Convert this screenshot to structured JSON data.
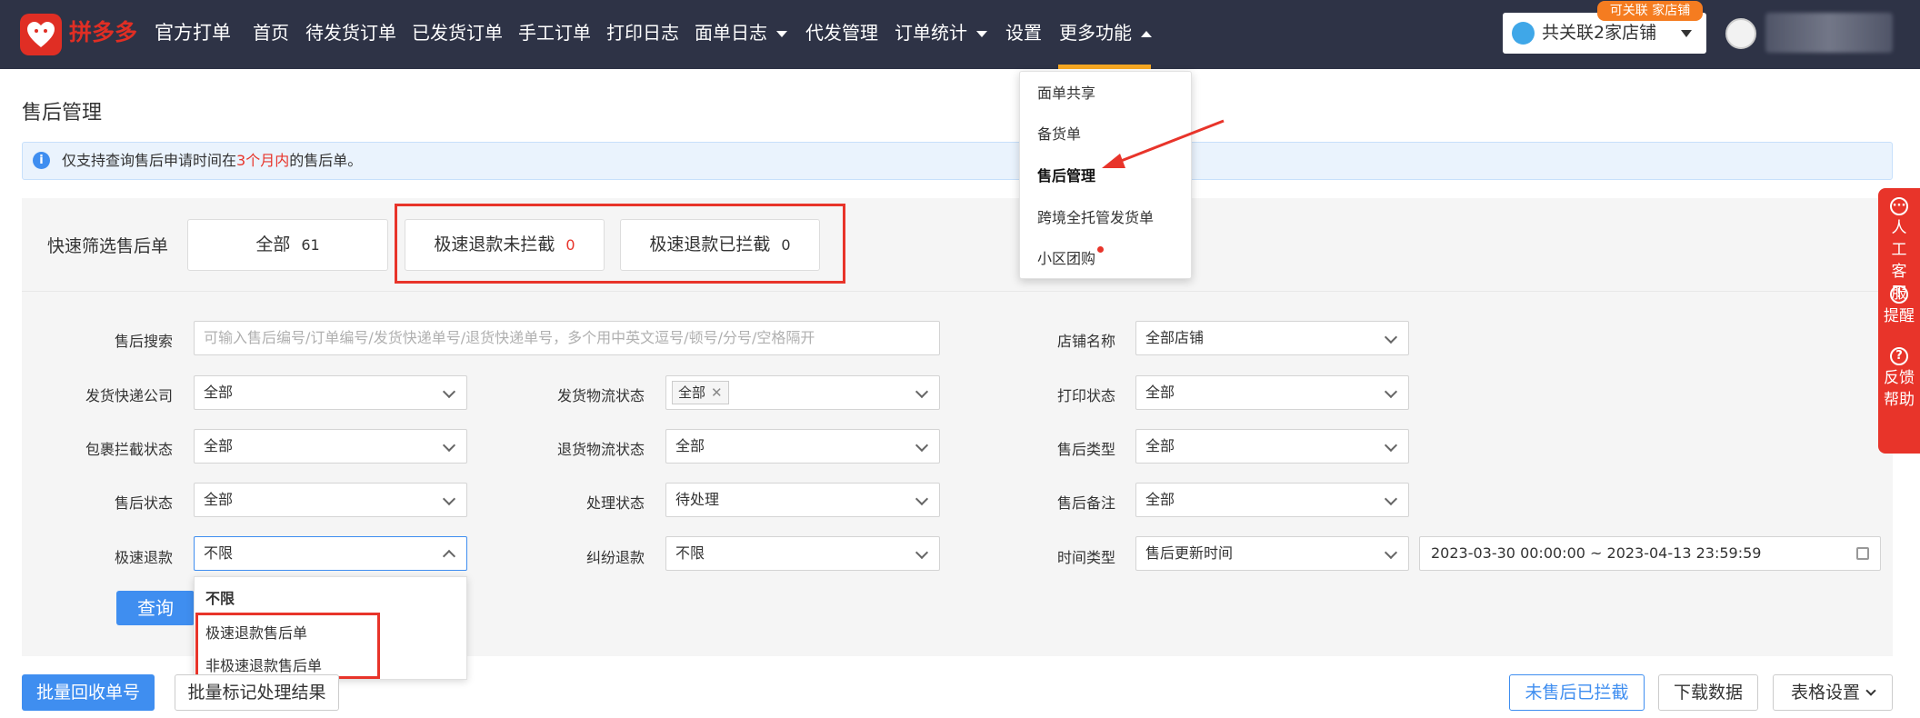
{
  "topbar": {
    "logo_text": "拼多多",
    "logo_sub": "官方打单",
    "nav": [
      "首页",
      "待发货订单",
      "已发货订单",
      "手工订单",
      "打印日志",
      "面单日志",
      "代发管理",
      "订单统计",
      "设置",
      "更多功能"
    ],
    "shop_badge": "可关联 家店铺",
    "shop_label": "共关联2家店铺"
  },
  "more_menu": {
    "items": [
      "面单共享",
      "备货单",
      "售后管理",
      "跨境全托管发货单",
      "小区团购"
    ]
  },
  "page": {
    "title": "售后管理",
    "notice_pre": "仅支持查询售后申请时间在",
    "notice_highlight": "3个月内",
    "notice_post": "的售后单。"
  },
  "quick_filter": {
    "label": "快速筛选售后单",
    "buttons": [
      {
        "label": "全部",
        "count": "61"
      },
      {
        "label": "极速退款未拦截",
        "count": "0"
      },
      {
        "label": "极速退款已拦截",
        "count": "0"
      }
    ]
  },
  "form": {
    "search_label": "售后搜索",
    "search_placeholder": "可输入售后编号/订单编号/发货快递单号/退货快递单号，多个用中英文逗号/顿号/分号/空格隔开",
    "shop_label": "店铺名称",
    "shop_value": "全部店铺",
    "ship_company_label": "发货快递公司",
    "ship_company_value": "全部",
    "ship_status_label": "发货物流状态",
    "ship_status_tag": "全部",
    "print_status_label": "打印状态",
    "print_status_value": "全部",
    "intercept_label": "包裹拦截状态",
    "intercept_value": "全部",
    "return_status_label": "退货物流状态",
    "return_status_value": "全部",
    "aftersale_type_label": "售后类型",
    "aftersale_type_value": "全部",
    "aftersale_status_label": "售后状态",
    "aftersale_status_value": "全部",
    "process_status_label": "处理状态",
    "process_status_value": "待处理",
    "remark_label": "售后备注",
    "remark_value": "全部",
    "fast_refund_label": "极速退款",
    "fast_refund_value": "不限",
    "dispute_label": "纠纷退款",
    "dispute_value": "不限",
    "time_type_label": "时间类型",
    "time_type_value": "售后更新时间",
    "date_range": "2023-03-30 00:00:00 ~ 2023-04-13 23:59:59",
    "query_button": "查询"
  },
  "fast_refund_dropdown": {
    "options": [
      "不限",
      "极速退款售后单",
      "非极速退款售后单"
    ]
  },
  "actions": {
    "batch_recycle": "批量回收单号",
    "batch_mark": "批量标记处理结果",
    "not_intercepted": "未售后已拦截",
    "download": "下载数据",
    "table_settings": "表格设置"
  },
  "side_widget": {
    "items": [
      "人工客服",
      "提醒",
      "反馈帮助"
    ]
  },
  "colors": {
    "topbar": "#2e3346",
    "brand_red": "#e8342a",
    "primary_blue": "#3f8ef0",
    "accent_orange": "#f7a823"
  }
}
